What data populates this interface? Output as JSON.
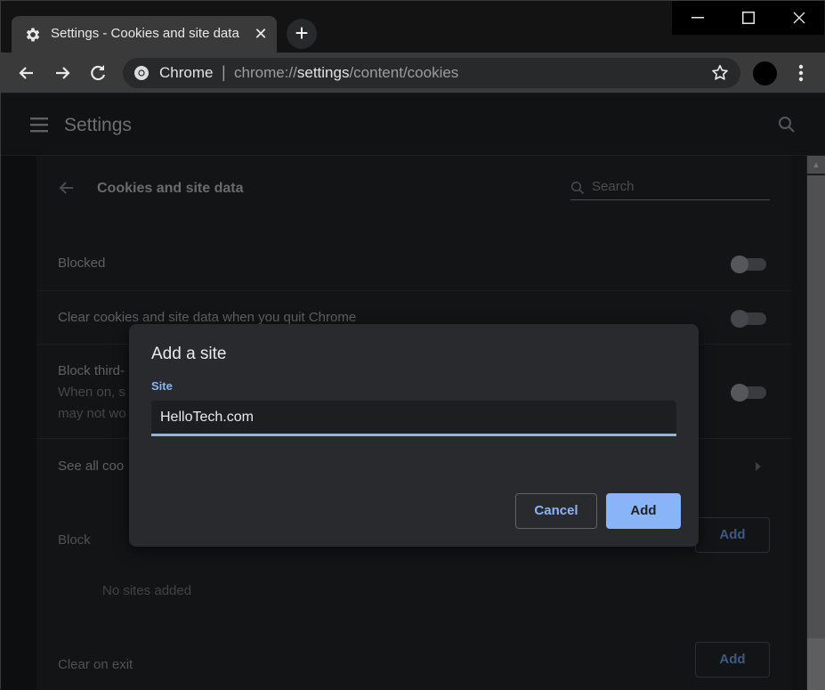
{
  "window": {
    "tab_title": "Settings - Cookies and site data",
    "tab_icon": "gear-icon",
    "new_tab_label": "+",
    "controls": [
      "minimize",
      "maximize",
      "close"
    ]
  },
  "toolbar": {
    "site_name": "Chrome",
    "separator": "|",
    "url_prefix": "chrome://",
    "url_highlight": "settings",
    "url_suffix": "/content/cookies"
  },
  "settings": {
    "app_title": "Settings",
    "page_title": "Cookies and site data",
    "search_placeholder": "Search",
    "rows": [
      {
        "label": "Blocked",
        "toggle": false
      },
      {
        "label": "Clear cookies and site data when you quit Chrome",
        "toggle": false
      },
      {
        "label": "Block third-",
        "sub1": "When on, s",
        "sub2": "may not wo",
        "toggle": false
      },
      {
        "label": "See all coo"
      }
    ],
    "sections": [
      {
        "label": "Block",
        "button": "Add",
        "empty": "No sites added"
      },
      {
        "label": "Clear on exit",
        "button": "Add"
      }
    ]
  },
  "dialog": {
    "title": "Add a site",
    "field_label": "Site",
    "field_value": "HelloTech.com",
    "cancel_label": "Cancel",
    "add_label": "Add"
  },
  "colors": {
    "accent": "#8ab4f8",
    "dialog_bg": "#292a2d"
  }
}
